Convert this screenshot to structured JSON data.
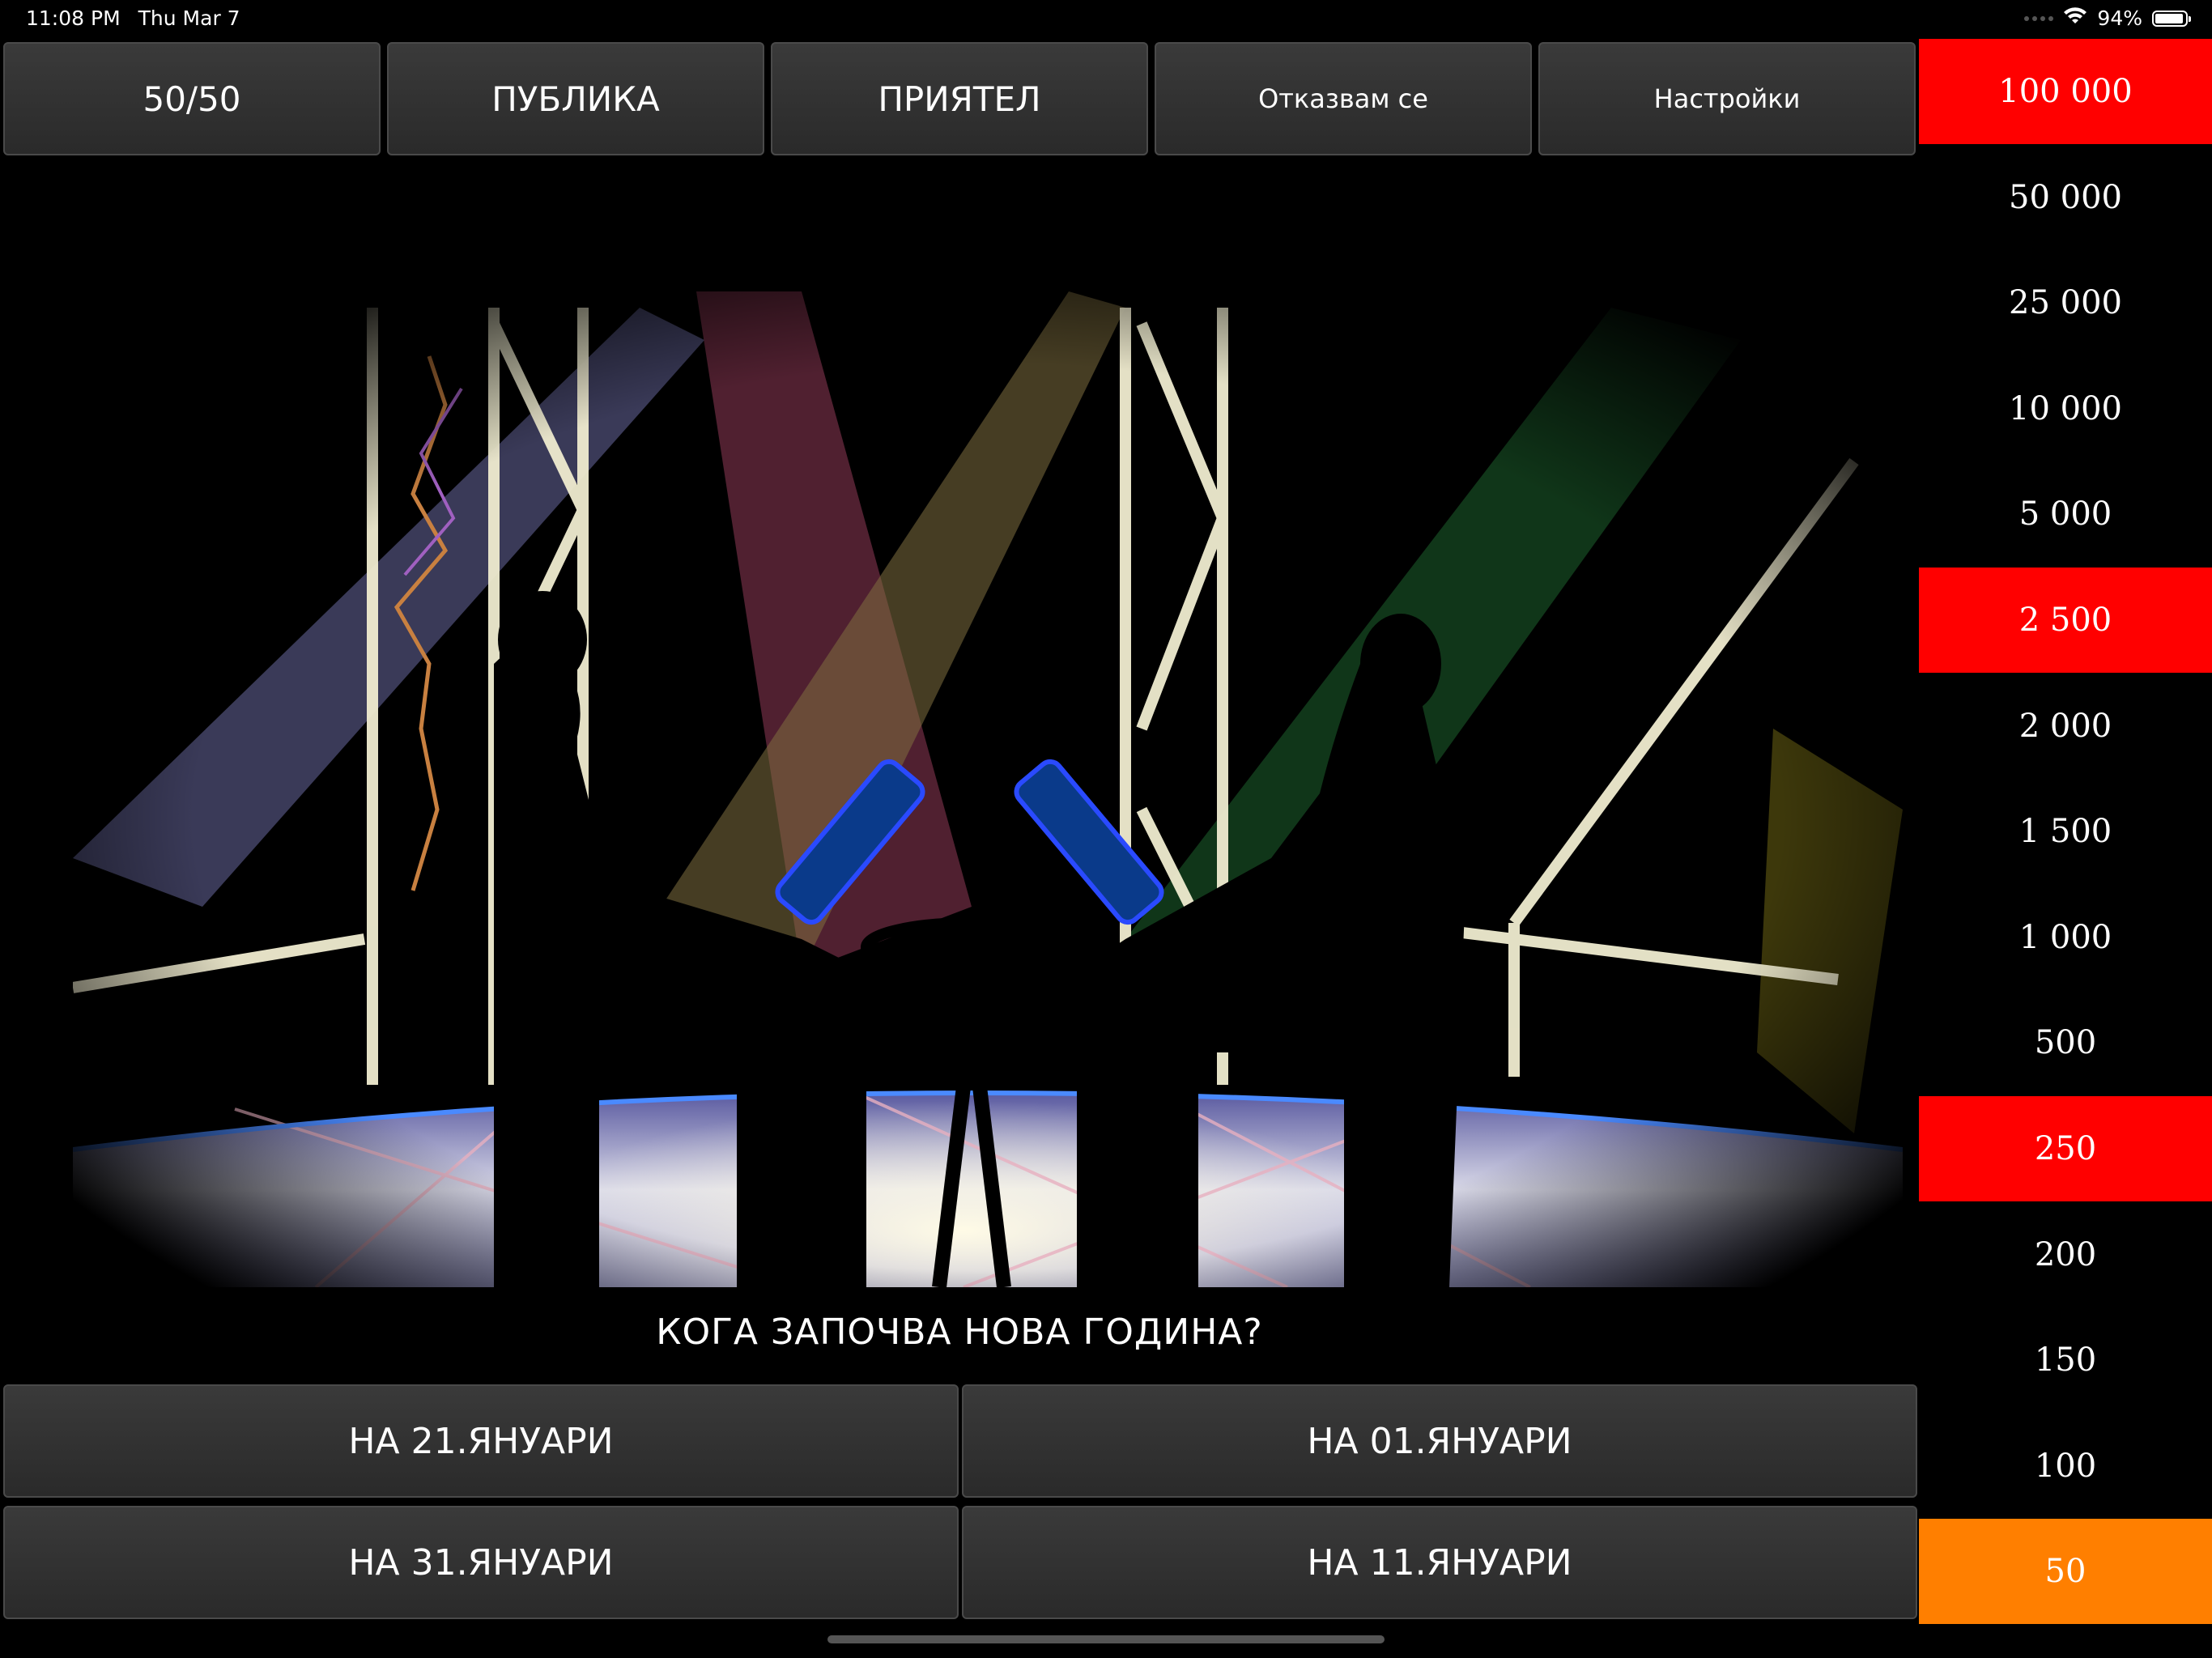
{
  "status_bar": {
    "time": "11:08 PM",
    "date": "Thu Mar 7",
    "battery_text": "94%",
    "battery_level": 0.94
  },
  "lifelines": {
    "fifty_fifty": "50/50",
    "audience": "ПУБЛИКА",
    "friend": "ПРИЯТЕЛ",
    "quit": "Отказвам се",
    "settings": "Настройки"
  },
  "prize_ladder": [
    {
      "amount": "100 000",
      "state": "milestone"
    },
    {
      "amount": "50 000",
      "state": "normal"
    },
    {
      "amount": "25 000",
      "state": "normal"
    },
    {
      "amount": "10 000",
      "state": "normal"
    },
    {
      "amount": "5 000",
      "state": "normal"
    },
    {
      "amount": "2 500",
      "state": "milestone"
    },
    {
      "amount": "2 000",
      "state": "normal"
    },
    {
      "amount": "1 500",
      "state": "normal"
    },
    {
      "amount": "1 000",
      "state": "normal"
    },
    {
      "amount": "500",
      "state": "normal"
    },
    {
      "amount": "250",
      "state": "milestone"
    },
    {
      "amount": "200",
      "state": "normal"
    },
    {
      "amount": "150",
      "state": "normal"
    },
    {
      "amount": "100",
      "state": "normal"
    },
    {
      "amount": "50",
      "state": "current"
    }
  ],
  "question": "КОГА ЗАПОЧВА НОВА ГОДИНА?",
  "answers": [
    "НА 21.ЯНУАРИ",
    "НА 01.ЯНУАРИ",
    "НА 31.ЯНУАРИ",
    "НА 11.ЯНУАРИ"
  ],
  "colors": {
    "milestone": "#ff0000",
    "current": "#ff7f00",
    "button_bg": "#333333"
  }
}
